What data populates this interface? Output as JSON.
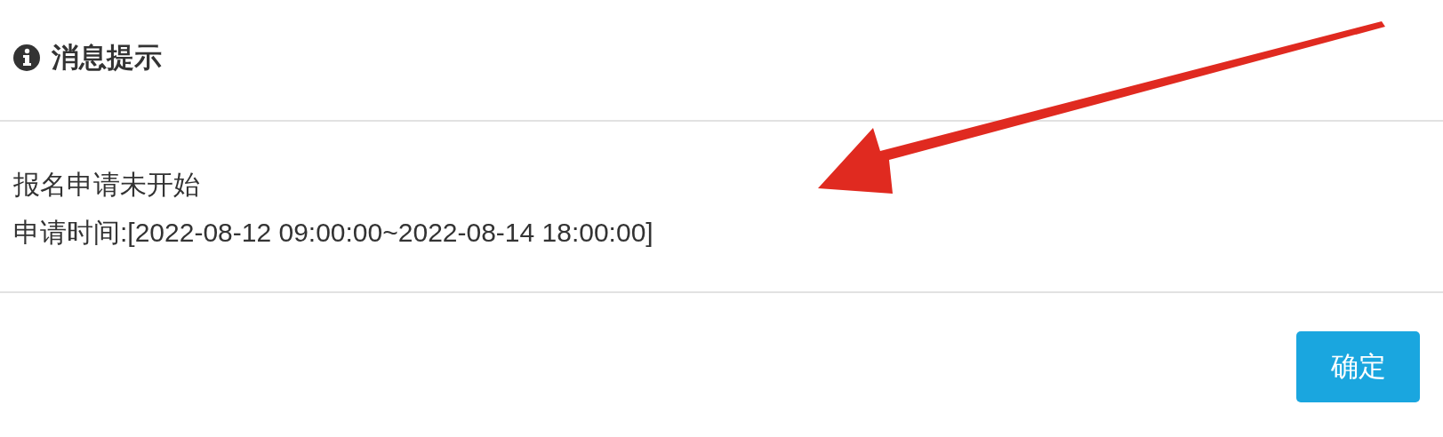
{
  "dialog": {
    "title": "消息提示",
    "message_lines": [
      "报名申请未开始",
      "申请时间:[2022-08-12 09:00:00~2022-08-14 18:00:00]"
    ],
    "buttons": [
      {
        "label": "确定"
      }
    ]
  }
}
